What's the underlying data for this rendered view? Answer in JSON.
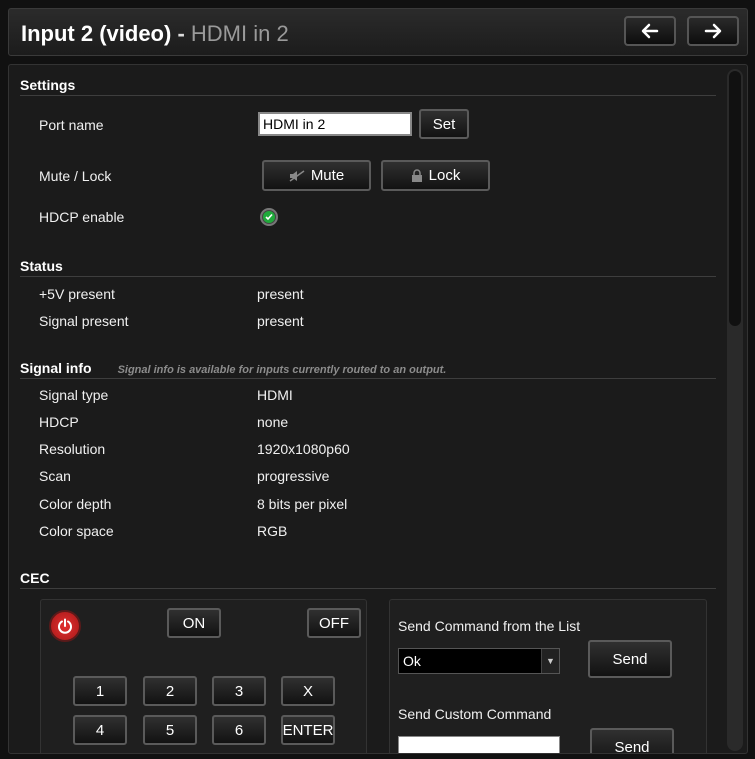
{
  "header": {
    "title": "Input 2 (video)",
    "separator": " - ",
    "subtitle": "HDMI in 2",
    "back_icon": "arrow-left-icon",
    "forward_icon": "arrow-right-icon"
  },
  "settings": {
    "heading": "Settings",
    "port_name_label": "Port name",
    "port_name_value": "HDMI in 2",
    "set_label": "Set",
    "mute_lock_label": "Mute / Lock",
    "mute_label": "Mute",
    "lock_label": "Lock",
    "hdcp_enable_label": "HDCP enable",
    "hdcp_enabled": true
  },
  "status": {
    "heading": "Status",
    "rows": [
      {
        "label": "+5V present",
        "value": "present"
      },
      {
        "label": "Signal present",
        "value": "present"
      }
    ]
  },
  "signal_info": {
    "heading": "Signal info",
    "note": "Signal info is available for inputs currently routed to an output.",
    "rows": [
      {
        "label": "Signal type",
        "value": "HDMI"
      },
      {
        "label": "HDCP",
        "value": "none"
      },
      {
        "label": "Resolution",
        "value": "1920x1080p60"
      },
      {
        "label": "Scan",
        "value": "progressive"
      },
      {
        "label": "Color depth",
        "value": "8 bits per pixel"
      },
      {
        "label": "Color space",
        "value": "RGB"
      }
    ]
  },
  "cec": {
    "heading": "CEC",
    "on_label": "ON",
    "off_label": "OFF",
    "keys": [
      "1",
      "2",
      "3",
      "X",
      "4",
      "5",
      "6",
      "ENTER"
    ],
    "send_from_list_label": "Send Command from the List",
    "selected_command": "Ok",
    "send_label": "Send",
    "send_custom_label": "Send Custom Command",
    "send_custom_button_label": "Send"
  },
  "colors": {
    "accent_green": "#1faa3a",
    "power_red": "#e23030"
  }
}
